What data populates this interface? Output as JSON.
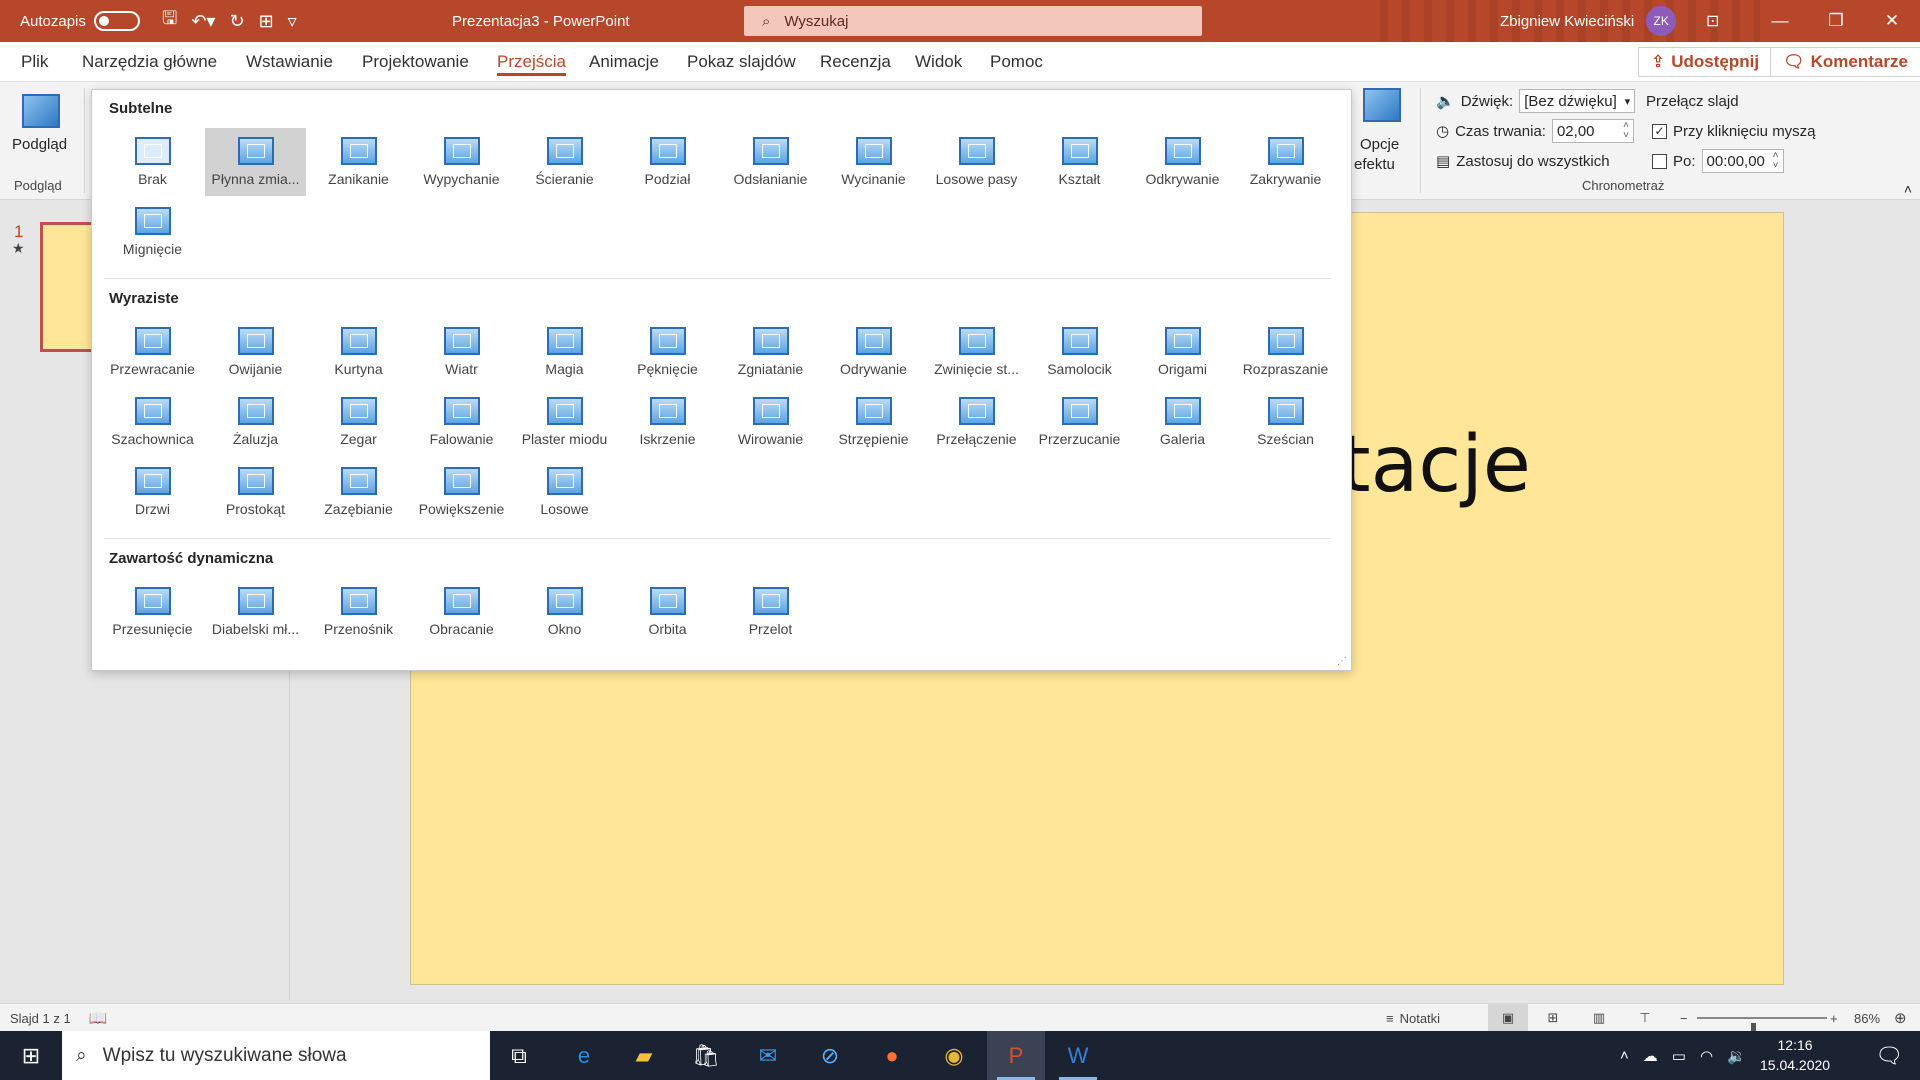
{
  "titlebar": {
    "autosave_label": "Autozapis",
    "doc_title": "Prezentacja3  -  PowerPoint",
    "search_placeholder": "Wyszukaj",
    "user_name": "Zbigniew Kwieciński",
    "user_initials": "ZK"
  },
  "tabs": [
    "Plik",
    "Narzędzia główne",
    "Wstawianie",
    "Projektowanie",
    "Przejścia",
    "Animacje",
    "Pokaz slajdów",
    "Recenzja",
    "Widok",
    "Pomoc"
  ],
  "active_tab": "Przejścia",
  "share_label": "Udostępnij",
  "comments_label": "Komentarze",
  "ribbon": {
    "preview_label": "Podgląd",
    "preview_group": "Podgląd",
    "effect_options_line1": "Opcje",
    "effect_options_line2": "efektu",
    "sound_label": "Dźwięk:",
    "sound_value": "[Bez dźwięku]",
    "duration_label": "Czas trwania:",
    "duration_value": "02,00",
    "apply_all_label": "Zastosuj do wszystkich",
    "advance_label": "Przełącz slajd",
    "on_click_label": "Przy kliknięciu myszą",
    "after_label": "Po:",
    "after_value": "00:00,00",
    "timing_group": "Chronometraż"
  },
  "gallery": {
    "section_subtle": "Subtelne",
    "section_exciting": "Wyraziste",
    "section_dynamic": "Zawartość dynamiczna",
    "subtle": [
      "Brak",
      "Płynna zmia...",
      "Zanikanie",
      "Wypychanie",
      "Ścieranie",
      "Podział",
      "Odsłanianie",
      "Wycinanie",
      "Losowe pasy",
      "Kształt",
      "Odkrywanie",
      "Zakrywanie",
      "Mignięcie"
    ],
    "exciting": [
      "Przewracanie",
      "Owijanie",
      "Kurtyna",
      "Wiatr",
      "Magia",
      "Pęknięcie",
      "Zgniatanie",
      "Odrywanie",
      "Zwinięcie st...",
      "Samolocik",
      "Origami",
      "Rozpraszanie",
      "Szachownica",
      "Żaluzja",
      "Zegar",
      "Falowanie",
      "Plaster miodu",
      "Iskrzenie",
      "Wirowanie",
      "Strzępienie",
      "Przełączenie",
      "Przerzucanie",
      "Galeria",
      "Sześcian",
      "Drzwi",
      "Prostokąt",
      "Zazębianie",
      "Powiększenie",
      "Losowe"
    ],
    "dynamic": [
      "Przesunięcie",
      "Diabelski mł...",
      "Przenośnik",
      "Obracanie",
      "Okno",
      "Orbita",
      "Przelot"
    ],
    "selected": "Płynna zmia..."
  },
  "slide": {
    "number": "1",
    "title_visible": "tacje"
  },
  "statusbar": {
    "slide_info": "Slajd 1 z 1",
    "notes_label": "Notatki",
    "zoom": "86%",
    "zoom_fraction": 0.43
  },
  "taskbar": {
    "search_placeholder": "Wpisz tu wyszukiwane słowa",
    "time": "12:16",
    "date": "15.04.2020"
  }
}
